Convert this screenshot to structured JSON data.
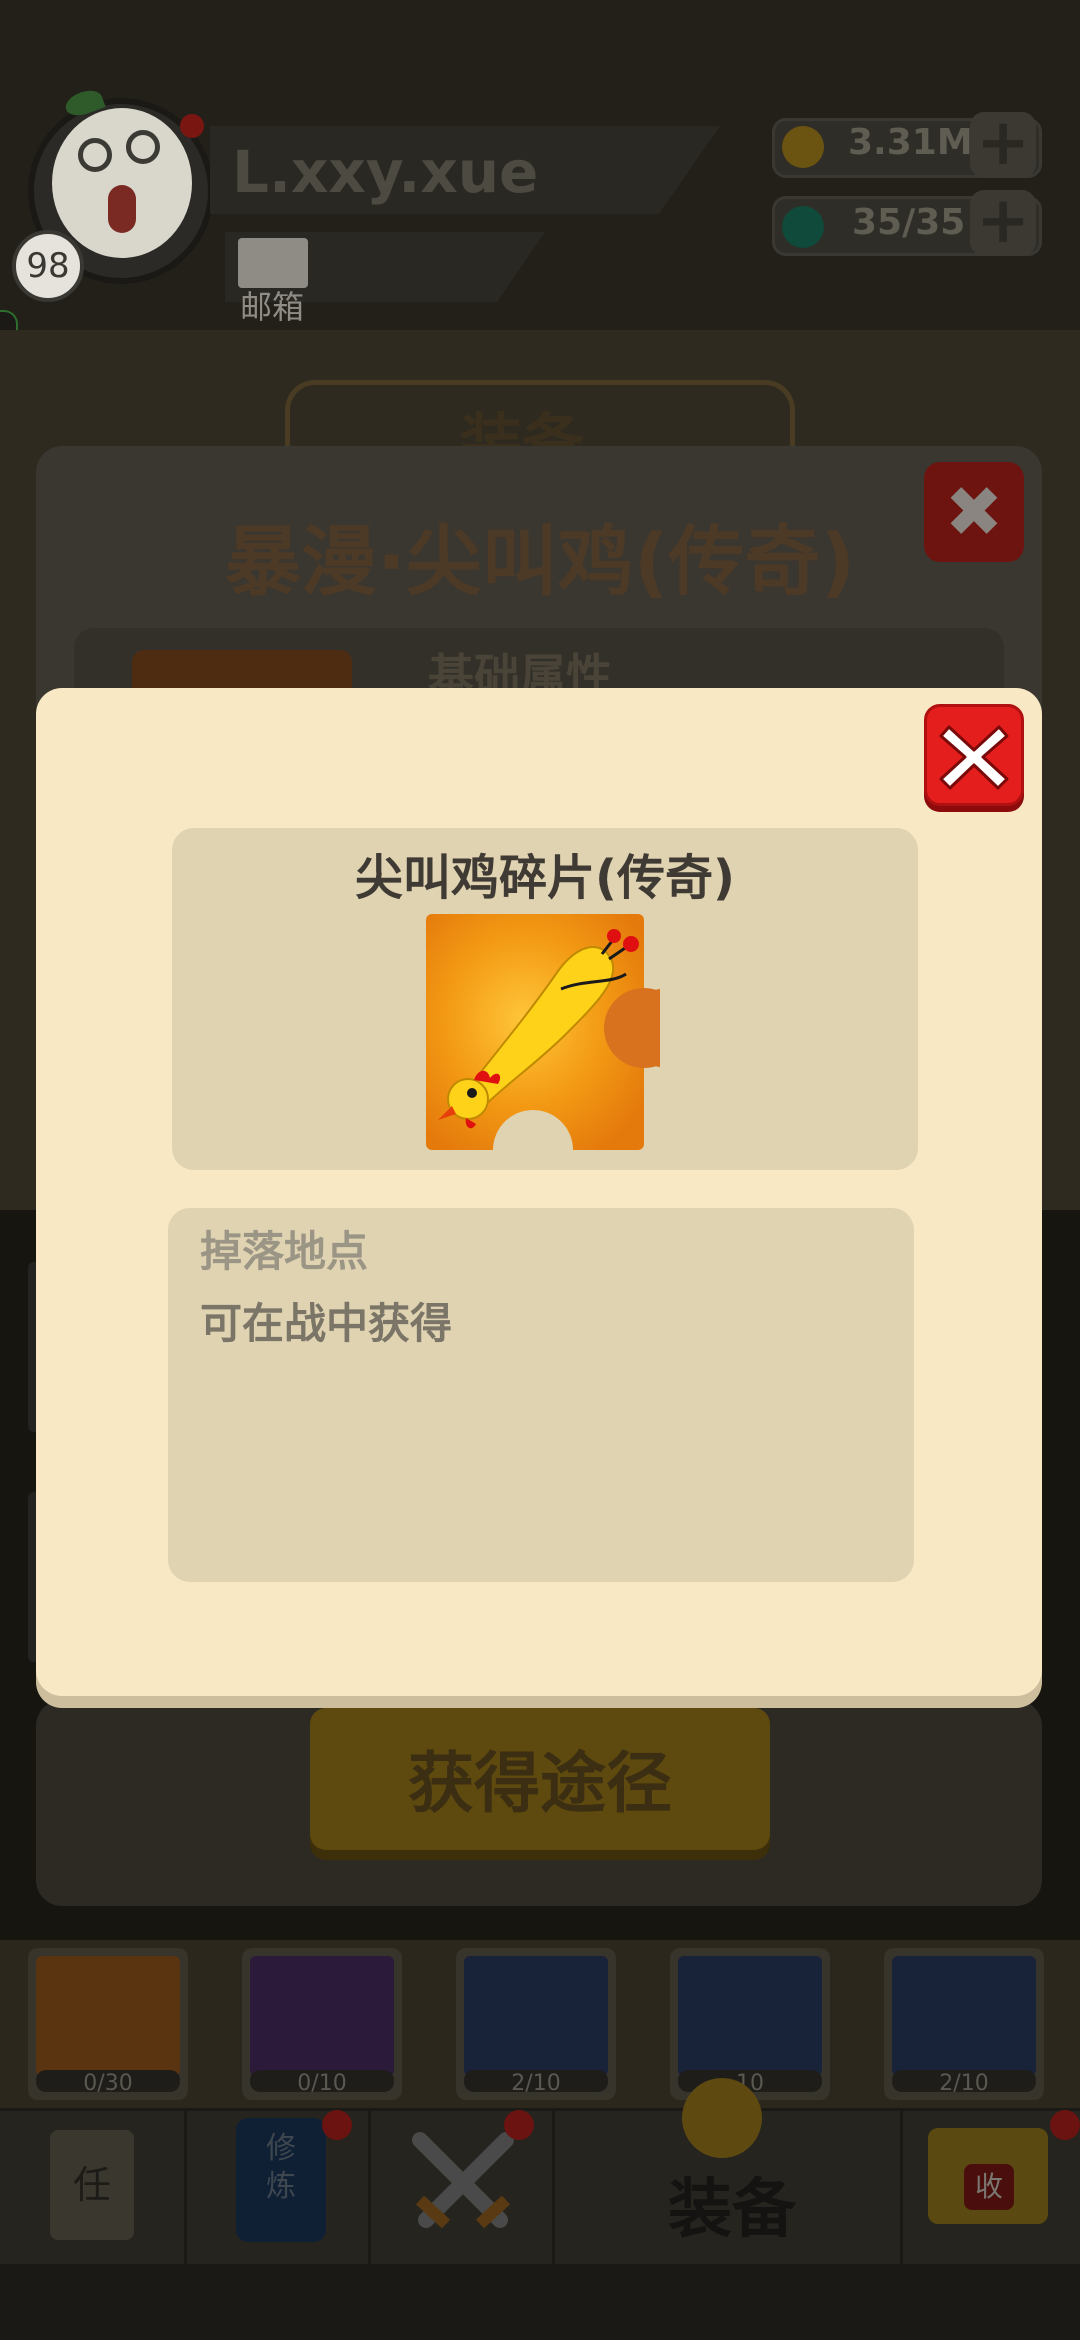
{
  "player": {
    "name": "L.xxy.xue",
    "level": "98",
    "mail_label": "邮箱"
  },
  "resources": [
    {
      "icon": "gold-coin-icon",
      "value": "3.31M",
      "color": "#c9a21f"
    },
    {
      "icon": "gem-icon",
      "value": "35/35",
      "color": "#1a9a7a"
    }
  ],
  "background_panel": {
    "section_header": "装备",
    "item_title": "暴漫·尖叫鸡(传奇)",
    "attributes_label": "基础属性",
    "get_route_button": "获得途径"
  },
  "equipment_slots": [
    {
      "icon": "shirt-icon",
      "count": "0/30",
      "tint": "#5a3410"
    },
    {
      "icon": "blade-icon",
      "count": "0/10",
      "tint": "#2c1a3a"
    },
    {
      "icon": "blade-icon",
      "count": "2/10",
      "tint": "#182238"
    },
    {
      "icon": "chest-armor-icon",
      "count": "10",
      "tint": "#182238"
    },
    {
      "icon": "orb-armor-icon",
      "count": "2/10",
      "tint": "#182238"
    }
  ],
  "bottom_nav": [
    {
      "id": "task",
      "icon": "task-scroll-icon",
      "glyph": "任"
    },
    {
      "id": "train",
      "icon": "training-book-icon",
      "glyph": "修炼"
    },
    {
      "id": "battle",
      "icon": "crossed-swords-icon",
      "glyph": ""
    },
    {
      "id": "equip",
      "icon": "equipment-icon",
      "label": "装备",
      "active": true
    },
    {
      "id": "collect",
      "icon": "collection-icon",
      "glyph": "收"
    }
  ],
  "dialog": {
    "shard_name": "尖叫鸡碎片(传奇)",
    "shard_icon": "screaming-chicken-shard-icon",
    "drop_heading": "掉落地点",
    "drop_text": "可在战中获得"
  },
  "colors": {
    "dialog_bg": "#f8e8c3",
    "panel_bg": "#e0d3b2",
    "close_red": "#e41d1d",
    "shard_orange": "#f08a10"
  }
}
